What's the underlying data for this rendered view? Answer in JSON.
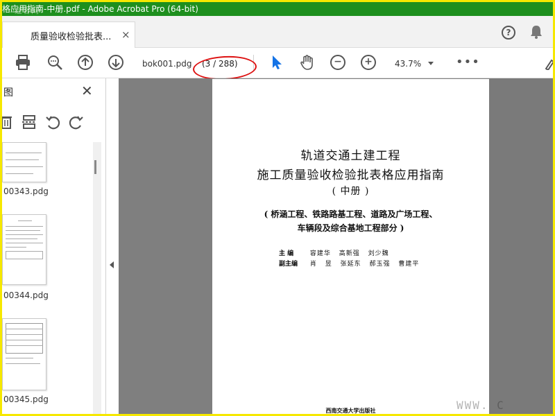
{
  "window": {
    "title": "格应用指南-中册.pdf - Adobe Acrobat Pro (64-bit)",
    "watermark_top": "道客网"
  },
  "tab": {
    "label": "质量验收检验批表...",
    "close_glyph": "×"
  },
  "header_icons": {
    "help": "?",
    "bell": "bell-icon"
  },
  "toolbar": {
    "page_field": "bok001.pdg",
    "page_count": "(3 / 288)",
    "zoom": "43.7%",
    "more": "•••",
    "zoom_out_glyph": "−",
    "zoom_in_glyph": "+"
  },
  "side_panel": {
    "title": "图",
    "close_glyph": "✕",
    "thumbnails": [
      {
        "label": "00343.pdg"
      },
      {
        "label": "00344.pdg"
      },
      {
        "label": "00345.pdg"
      }
    ]
  },
  "document": {
    "title_line1": "轨道交通土建工程",
    "title_line2": "施工质量验收检验批表格应用指南",
    "title_line3": "( 中册 )",
    "subtitle_line1": "( 桥涵工程、铁路路基工程、道路及广场工程、",
    "subtitle_line2": "车辆段及综合基地工程部分 )",
    "editor_role": "主    编",
    "editor_names": "容建华  高新强  刘少魏",
    "deputy_role": "副主编",
    "deputy_names": "肖 昱  张延东  郝玉强  曹建平",
    "publisher": "西南交通大学出版社"
  },
  "watermark_bottom": "WWW. C",
  "colors": {
    "titlebar": "#1e8f1e",
    "frame": "#f6e800",
    "annotation_ellipse": "#dd1111",
    "doc_background": "#7f7f7f",
    "select_tool": "#1473e6"
  }
}
